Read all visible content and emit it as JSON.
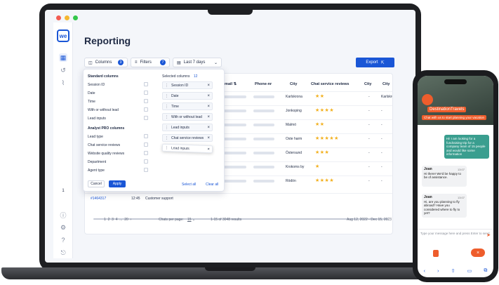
{
  "app": {
    "logo": "we",
    "page_title": "Reporting"
  },
  "sidebar": {
    "step_label": "1"
  },
  "toolbar": {
    "columns_label": "Columns",
    "columns_count": "3",
    "filters_label": "Filters",
    "filters_count": "7",
    "date_range": "Last 7 days",
    "export_label": "Export"
  },
  "table": {
    "headers": [
      "email",
      "Phone-nr",
      "City",
      "Chat service reviews",
      "City",
      "City"
    ],
    "rows": [
      {
        "city": "Karlskrona",
        "stars": "★★",
        "city2": "-",
        "city3": "Karlskrona"
      },
      {
        "city": "Jonkoping",
        "stars": "★★★★",
        "city2": "-",
        "city3": "-"
      },
      {
        "city": "Malmö",
        "stars": "★★",
        "city2": "-",
        "city3": "-"
      },
      {
        "city": "Oste harm",
        "stars": "★★★★★",
        "city2": "-",
        "city3": "-"
      },
      {
        "city": "Östersund",
        "stars": "★★★",
        "city2": "-",
        "city3": "-"
      },
      {
        "city": "Krokoms by",
        "stars": "★",
        "city2": "-",
        "city3": "-"
      },
      {
        "city": "Rödön",
        "stars": "★★★★",
        "city2": "-",
        "city3": "-"
      }
    ],
    "last_row": {
      "id": "#1464317",
      "ts": "12:45",
      "dept": "Customer support"
    }
  },
  "pagination": {
    "pages": [
      "1",
      "2",
      "3",
      "4",
      "...",
      "20"
    ],
    "rows_per_page_label": "Chats per page:",
    "rows_per_page": "15",
    "range_text": "1-15 of 3048 results",
    "date_span": "Aug 12, 2022 - Dec 15, 2023"
  },
  "columns_popup": {
    "standard_heading": "Standard columns",
    "standard_items": [
      "Session ID",
      "Date",
      "Time",
      "With or without lead",
      "Lead inputs"
    ],
    "analyst_heading": "Analyst PRO columns",
    "analyst_items": [
      "Lead type",
      "Chat service reviews",
      "Website quality reviews",
      "Department",
      "Agent type"
    ],
    "selected_heading": "Selected columns",
    "selected_count": "12",
    "selected_items": [
      "Session ID",
      "Date",
      "Time",
      "With or without lead",
      "Lead inputs",
      "Chat service reviews",
      "Lead inputs"
    ],
    "cancel_label": "Cancel",
    "apply_label": "Apply",
    "select_all_label": "Select all",
    "clear_all_label": "Clear all"
  },
  "phone": {
    "brand": "DestinationTravels",
    "brand_sub": "Chat with us to start planning your vacation",
    "messages": [
      {
        "name": "",
        "text": "Hi! I am looking for a fundraising trip for a company team of 15 people and would like some information",
        "time": ""
      },
      {
        "name": "Joan",
        "text": "Hi there! We'd be happy to be of assistance.",
        "time": "13:07"
      },
      {
        "name": "Joan",
        "text": "Hi, are you planning to fly abroad? Have you considered where to fly to yet?",
        "time": "13:07"
      }
    ],
    "composer_placeholder": "Type your message here and press Enter to send",
    "close_label": "×"
  }
}
